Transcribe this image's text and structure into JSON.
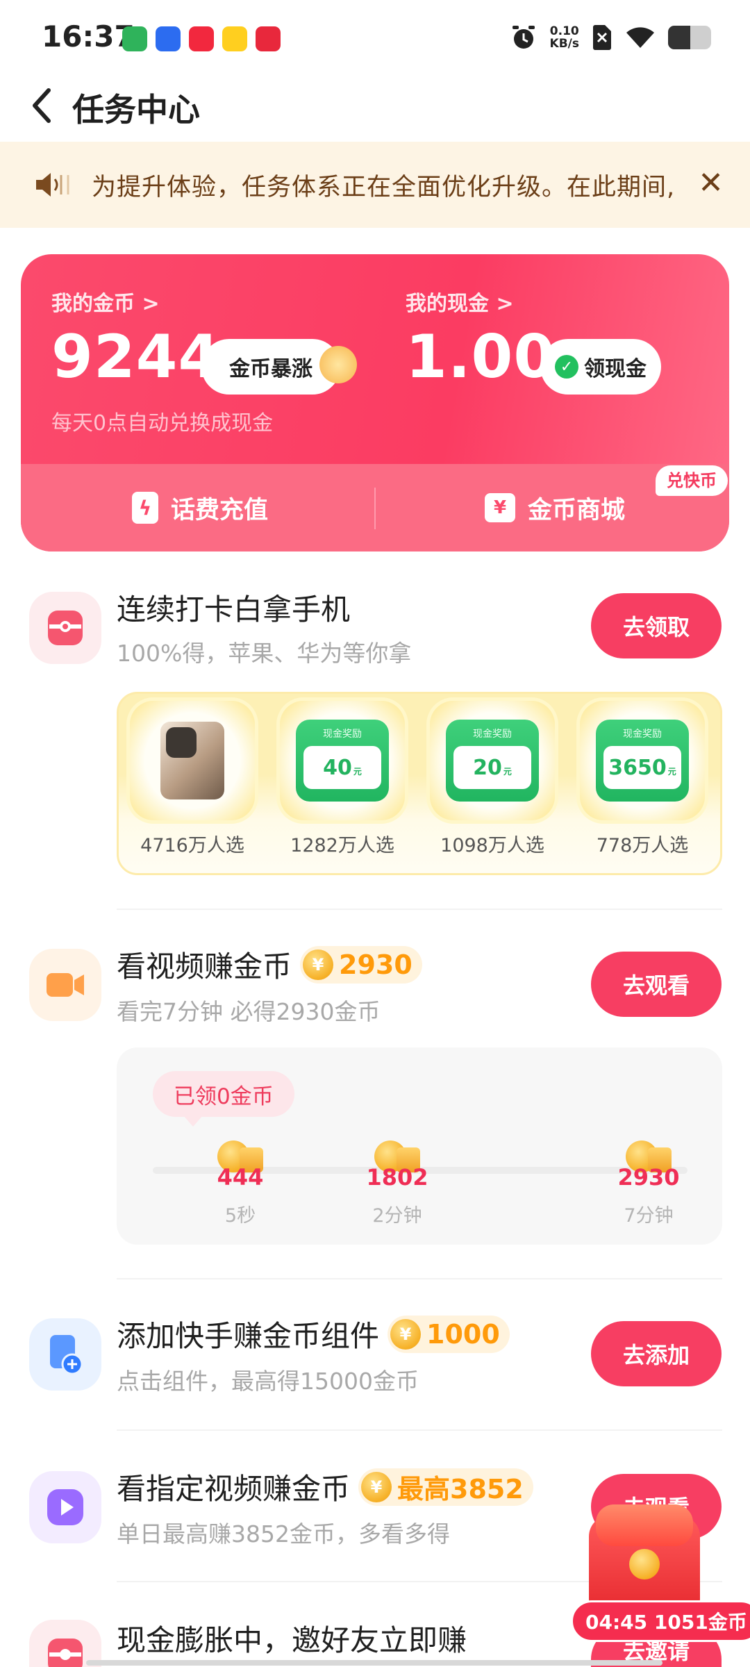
{
  "status_bar": {
    "time": "16:37",
    "net_speed_value": "0.10",
    "net_speed_unit": "KB/s"
  },
  "header": {
    "title": "任务中心"
  },
  "notice": {
    "text": "为提升体验，任务体系正在全面优化升级。在此期间,"
  },
  "wallet": {
    "coins_label": "我的金币 >",
    "coins_value": "9244",
    "coins_pill": "金币暴涨",
    "cash_label": "我的现金 >",
    "cash_value": "1.00",
    "cash_pill": "领现金",
    "note": "每天0点自动兑换成现金",
    "recharge_label": "话费充值",
    "mall_label": "金币商城",
    "mall_tag": "兑快币"
  },
  "tasks": [
    {
      "title": "连续打卡白拿手机",
      "subtitle": "100%得，苹果、华为等你拿",
      "button": "去领取"
    },
    {
      "title": "看视频赚金币",
      "badge": "2930",
      "subtitle": "看完7分钟 必得2930金币",
      "button": "去观看"
    },
    {
      "title": "添加快手赚金币组件",
      "badge": "1000",
      "subtitle": "点击组件，最高得15000金币",
      "button": "去添加"
    },
    {
      "title": "看指定视频赚金币",
      "badge": "最高3852",
      "subtitle": "单日最高赚3852金币，多看多得",
      "button": "去观看"
    },
    {
      "title": "现金膨胀中，邀好友立即赚",
      "button": "去邀请"
    }
  ],
  "prizes": [
    {
      "count": "4716万人选"
    },
    {
      "card_label": "现金奖励",
      "amount": "40",
      "unit": "元",
      "count": "1282万人选"
    },
    {
      "card_label": "现金奖励",
      "amount": "20",
      "unit": "元",
      "count": "1098万人选"
    },
    {
      "card_label": "现金奖励",
      "amount": "3650",
      "unit": "元",
      "count": "778万人选"
    }
  ],
  "video_progress": {
    "claimed": "已领0金币",
    "milestones": [
      {
        "coins": "444",
        "time": "5秒"
      },
      {
        "coins": "1802",
        "time": "2分钟"
      },
      {
        "coins": "2930",
        "time": "7分钟"
      }
    ]
  },
  "floating": {
    "timer": "04:45 1051金币"
  }
}
